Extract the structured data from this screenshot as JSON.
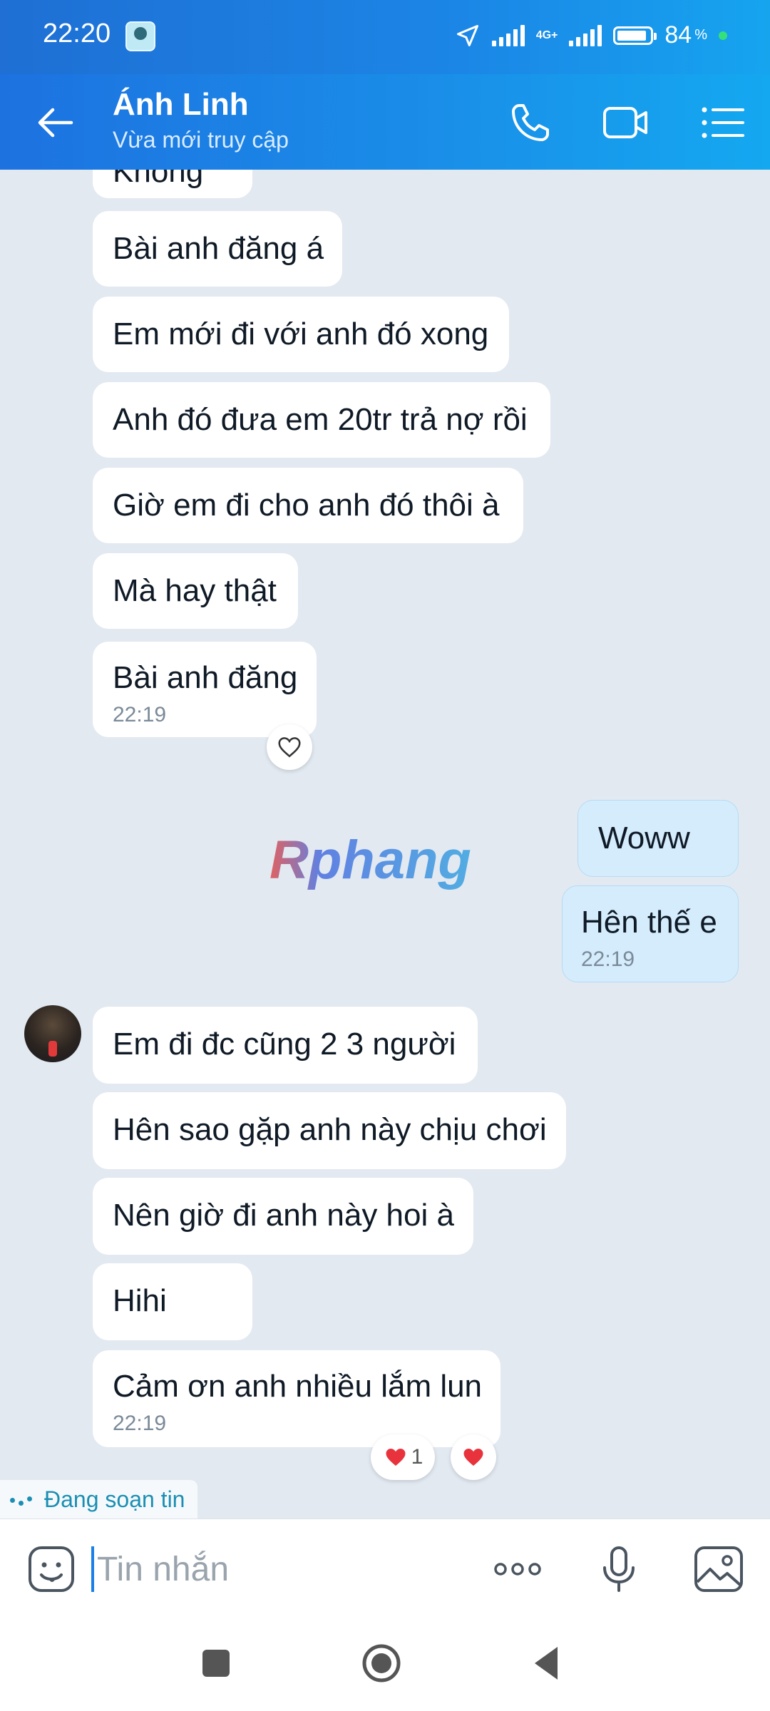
{
  "status_bar": {
    "time": "22:20",
    "network": "4G+",
    "battery_percent": "84",
    "battery_sign": "%"
  },
  "header": {
    "contact_name": "Ánh Linh",
    "contact_status": "Vừa mới truy cập",
    "icons": [
      "back-arrow-icon",
      "phone-icon",
      "video-call-icon",
      "menu-list-icon"
    ]
  },
  "messages": [
    {
      "side": "in",
      "text": "Không"
    },
    {
      "side": "in",
      "text": "Bài anh đăng á"
    },
    {
      "side": "in",
      "text": "Em mới đi với anh đó xong"
    },
    {
      "side": "in",
      "text": "Anh đó đưa em 20tr trả nợ rồi"
    },
    {
      "side": "in",
      "text": "Giờ em đi cho anh đó thôi à"
    },
    {
      "side": "in",
      "text": "Mà hay thật"
    },
    {
      "side": "in",
      "text": "Bài anh đăng",
      "time": "22:19"
    },
    {
      "side": "out",
      "text": "Woww"
    },
    {
      "side": "out",
      "text": "Hên thế e",
      "time": "22:19"
    },
    {
      "side": "in",
      "text": "Em đi đc cũng 2 3 người"
    },
    {
      "side": "in",
      "text": "Hên sao gặp anh này chịu chơi"
    },
    {
      "side": "in",
      "text": "Nên giờ đi anh này hoi à"
    },
    {
      "side": "in",
      "text": "Hihi"
    },
    {
      "side": "in",
      "text": "Cảm ơn anh nhiều lắm lun",
      "time": "22:19"
    }
  ],
  "reactions": {
    "heart_count": "1"
  },
  "watermark": "Rphang",
  "typing_indicator": "Đang soạn tin",
  "input": {
    "placeholder": "Tin nhắn"
  },
  "colors": {
    "header_gradient_start": "#1d72e0",
    "header_gradient_end": "#14a8f0",
    "chat_background": "#e2e9f1",
    "outgoing_bubble": "#d5ecfc",
    "heart": "#e8333d",
    "typing_text": "#1a8fb3"
  }
}
